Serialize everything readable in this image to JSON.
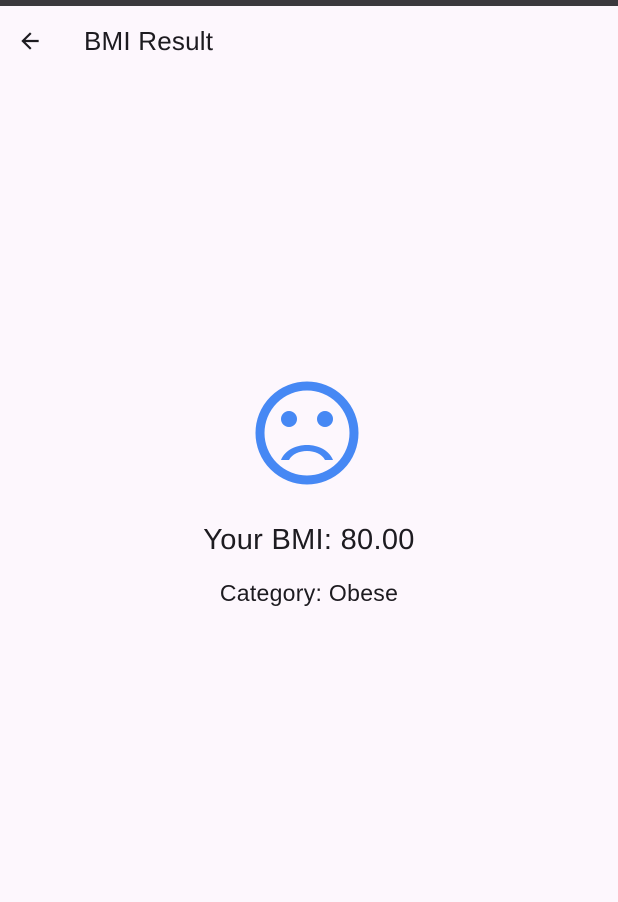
{
  "app_bar": {
    "title": "BMI Result",
    "back_icon": "arrow-back-icon"
  },
  "result": {
    "icon": "sad-face-icon",
    "icon_color": "#4688f4",
    "bmi_text": "Your BMI: 80.00",
    "category_text": "Category: Obese"
  },
  "colors": {
    "background": "#fdf7fd",
    "text": "#1d1b20",
    "status_strip": "#3b393d"
  }
}
